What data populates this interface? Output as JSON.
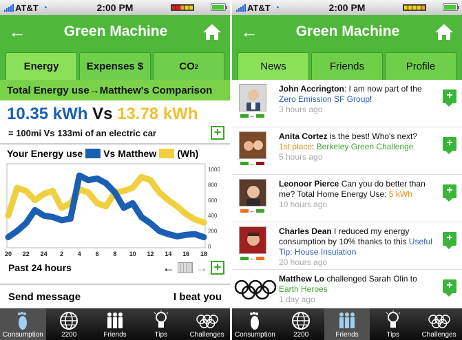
{
  "status_bar": {
    "carrier": "AT&T",
    "time": "2:00 PM"
  },
  "nav": {
    "title": "Green Machine"
  },
  "consumption": {
    "tabs": [
      "Energy",
      "Expenses $",
      "CO",
      "2"
    ],
    "section_header": "Total Energy use→Matthew's Comparison",
    "my_usage": "10.35 kWh",
    "vs_label": "Vs",
    "friend_usage": "13.78 kWh",
    "equivalence": "= 100mi Vs 133mi of an electric car",
    "legend_prefix": "Your Energy use",
    "legend_vs": "Vs Matthew",
    "legend_unit": "(Wh)",
    "past_label": "Past 24 hours",
    "send_message": "Send message",
    "beat_you": "I beat you",
    "colors": {
      "mine": "#1a5fb4",
      "friend": "#f0d040"
    }
  },
  "chart_data": {
    "type": "line",
    "x": [
      20,
      21,
      22,
      23,
      24,
      1,
      2,
      3,
      4,
      5,
      6,
      7,
      8,
      9,
      10,
      11,
      12,
      13,
      14,
      15,
      16,
      17,
      18
    ],
    "x_tick_labels": [
      "20",
      "22",
      "24",
      "2",
      "4",
      "6",
      "8",
      "10",
      "12",
      "14",
      "16",
      "18"
    ],
    "y_tick_labels": [
      "1000",
      "800",
      "600",
      "400",
      "200",
      "0"
    ],
    "ylim": [
      0,
      1000
    ],
    "series": [
      {
        "name": "Your Energy use",
        "color": "#1a5fb4",
        "values": [
          120,
          200,
          300,
          470,
          400,
          380,
          340,
          360,
          920,
          860,
          880,
          820,
          700,
          500,
          560,
          380,
          300,
          200,
          160,
          130,
          150,
          160,
          120
        ]
      },
      {
        "name": "Matthew",
        "color": "#f0d040",
        "values": [
          400,
          760,
          720,
          600,
          680,
          720,
          500,
          560,
          740,
          700,
          560,
          520,
          700,
          720,
          760,
          900,
          860,
          700,
          600,
          520,
          420,
          350,
          310
        ]
      }
    ]
  },
  "tab_bar": [
    "Consumption",
    "2200",
    "Friends",
    "Tips",
    "Challenges"
  ],
  "friends": {
    "tabs": [
      "News",
      "Friends",
      "Profile"
    ],
    "feed": [
      {
        "name": "John Accrington",
        "text": ": I am now part of the ",
        "link": "Zero Emission SF Group",
        "link2": "",
        "tail": "!",
        "time": "3 hours ago"
      },
      {
        "name": "Anita Cortez",
        "text": " is the best! Who's next?",
        "link": "1st place",
        "link2": "Berkeley Green Challenge",
        "tail": ": ",
        "time": "5 hours ago"
      },
      {
        "name": "Leonoor Pierce",
        "text": " Can you do better than me? Total Home Energy Use: ",
        "link": "5 kWh",
        "link2": "",
        "tail": "",
        "time": "10 hours ago"
      },
      {
        "name": "Charles Dean",
        "text": " I reduced my energy consumption by 10% thanks to this ",
        "link": "Useful Tip: House Insulation",
        "link2": "",
        "tail": "",
        "time": "20 hours ago"
      },
      {
        "name": "Matthew Lo",
        "text": " challenged Sarah Olin to ",
        "link": "Earth Heroes",
        "link2": "",
        "tail": "",
        "time": "1 day ago"
      }
    ]
  }
}
